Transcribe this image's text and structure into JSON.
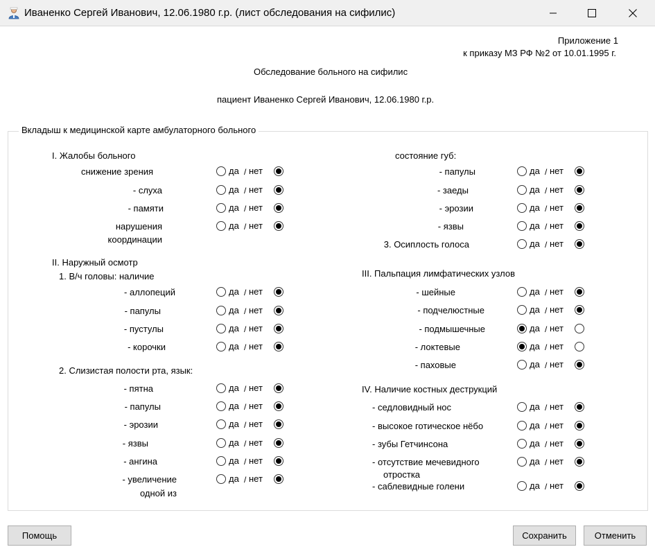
{
  "window": {
    "title": "Иваненко Сергей Иванович, 12.06.1980 г.р. (лист обследования на сифилис)"
  },
  "header": {
    "appendix_line1": "Приложение 1",
    "appendix_line2": "к приказу МЗ РФ №2 от 10.01.1995 г.",
    "form_title": "Обследование больного на сифилис",
    "patient_line": "пациент  Иваненко Сергей Иванович, 12.06.1980 г.р."
  },
  "group": {
    "title": "Вкладыш к медицинской карте амбулаторного больного"
  },
  "options": {
    "yes": "да",
    "no": "нет",
    "sep": "/"
  },
  "left": {
    "s1_title": "I. Жалобы больного",
    "s2_title": "II. Наружный осмотр",
    "s2_sub1": "1. В/ч головы: наличие",
    "s2_sub2": "2. Слизистая полости рта, язык:",
    "rows": [
      {
        "label": "снижение зрения",
        "value": "нет"
      },
      {
        "label": "- слуха",
        "value": "нет"
      },
      {
        "label": "- памяти",
        "value": "нет"
      },
      {
        "label": "нарушения",
        "label2": "координации",
        "value": "нет"
      },
      {
        "label": "- аллопеций",
        "value": "нет"
      },
      {
        "label": "- папулы",
        "value": "нет"
      },
      {
        "label": "- пустулы",
        "value": "нет"
      },
      {
        "label": "- корочки",
        "value": "нет"
      },
      {
        "label": "- пятна",
        "value": "нет"
      },
      {
        "label": "- папулы",
        "value": "нет"
      },
      {
        "label": "- эрозии",
        "value": "нет"
      },
      {
        "label": "- язвы",
        "value": "нет"
      },
      {
        "label": "- ангина",
        "value": "нет"
      },
      {
        "label": "- увеличение",
        "label2": "одной из",
        "value": "нет"
      }
    ]
  },
  "right": {
    "lips_title": "состояние губ:",
    "s3_title": "III. Пальпация лимфатических узлов",
    "s4_title": "IV. Наличие костных деструкций",
    "rows": [
      {
        "label": "- папулы",
        "value": "нет"
      },
      {
        "label": "- заеды",
        "value": "нет"
      },
      {
        "label": "- эрозии",
        "value": "нет"
      },
      {
        "label": "- язвы",
        "value": "нет"
      },
      {
        "label": "3. Осиплость голоса",
        "value": "нет"
      },
      {
        "label": "- шейные",
        "value": "нет"
      },
      {
        "label": "- подчелюстные",
        "value": "нет"
      },
      {
        "label": "- подмышечные",
        "value": "да"
      },
      {
        "label": "- локтевые",
        "value": "да"
      },
      {
        "label": "- паховые",
        "value": "нет"
      },
      {
        "label": "- седловидный нос",
        "value": "нет"
      },
      {
        "label": "- высокое готическое нёбо",
        "value": "нет"
      },
      {
        "label": "- зубы Гетчинсона",
        "value": "нет"
      },
      {
        "label": "- отсутствие мечевидного",
        "label2": "отростка",
        "value": "нет"
      },
      {
        "label": "- саблевидные голени",
        "value": "нет"
      }
    ]
  },
  "buttons": {
    "help": "Помощь",
    "save": "Сохранить",
    "cancel": "Отменить"
  }
}
